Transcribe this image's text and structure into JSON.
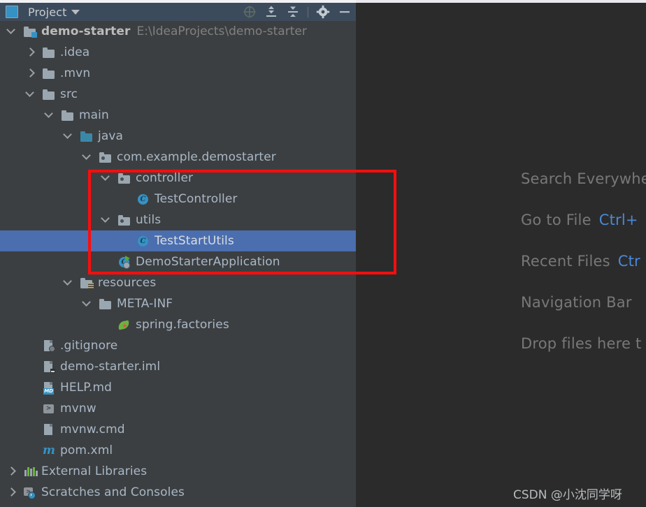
{
  "window": {
    "tool_window": {
      "title": "Project",
      "title_icon": "project-monitor-icon",
      "dropdown_icon": "chevron-down-icon",
      "actions": [
        {
          "name": "select-opened-file-icon",
          "label": "Select Opened File"
        },
        {
          "name": "expand-all-icon",
          "label": "Expand All"
        },
        {
          "name": "collapse-all-icon",
          "label": "Collapse All"
        },
        {
          "name": "settings-gear-icon",
          "label": "Settings"
        },
        {
          "name": "hide-icon",
          "label": "Hide"
        }
      ]
    }
  },
  "tree": {
    "rows": [
      {
        "indent": 0,
        "arrow": "down",
        "icon": "module-folder-icon",
        "label": "demo-starter",
        "bold": true,
        "path": "E:\\IdeaProjects\\demo-starter",
        "selected": false
      },
      {
        "indent": 1,
        "arrow": "right",
        "icon": "folder-icon",
        "label": ".idea",
        "bold": false,
        "path": "",
        "selected": false
      },
      {
        "indent": 1,
        "arrow": "right",
        "icon": "folder-icon",
        "label": ".mvn",
        "bold": false,
        "path": "",
        "selected": false
      },
      {
        "indent": 1,
        "arrow": "down",
        "icon": "folder-icon",
        "label": "src",
        "bold": false,
        "path": "",
        "selected": false
      },
      {
        "indent": 2,
        "arrow": "down",
        "icon": "folder-icon",
        "label": "main",
        "bold": false,
        "path": "",
        "selected": false
      },
      {
        "indent": 3,
        "arrow": "down",
        "icon": "source-root-folder-icon",
        "label": "java",
        "bold": false,
        "path": "",
        "selected": false
      },
      {
        "indent": 4,
        "arrow": "down",
        "icon": "package-icon",
        "label": "com.example.demostarter",
        "bold": false,
        "path": "",
        "selected": false
      },
      {
        "indent": 5,
        "arrow": "down",
        "icon": "package-icon",
        "label": "controller",
        "bold": false,
        "path": "",
        "selected": false
      },
      {
        "indent": 6,
        "arrow": "none",
        "icon": "java-class-icon",
        "label": "TestController",
        "bold": false,
        "path": "",
        "selected": false
      },
      {
        "indent": 5,
        "arrow": "down",
        "icon": "package-icon",
        "label": "utils",
        "bold": false,
        "path": "",
        "selected": false
      },
      {
        "indent": 6,
        "arrow": "none",
        "icon": "java-class-icon",
        "label": "TestStartUtils",
        "bold": false,
        "path": "",
        "selected": true
      },
      {
        "indent": 5,
        "arrow": "none",
        "icon": "spring-boot-app-icon",
        "label": "DemoStarterApplication",
        "bold": false,
        "path": "",
        "selected": false
      },
      {
        "indent": 3,
        "arrow": "down",
        "icon": "resources-folder-icon",
        "label": "resources",
        "bold": false,
        "path": "",
        "selected": false
      },
      {
        "indent": 4,
        "arrow": "down",
        "icon": "folder-icon",
        "label": "META-INF",
        "bold": false,
        "path": "",
        "selected": false
      },
      {
        "indent": 5,
        "arrow": "none",
        "icon": "spring-factories-icon",
        "label": "spring.factories",
        "bold": false,
        "path": "",
        "selected": false
      },
      {
        "indent": 1,
        "arrow": "none",
        "icon": "gitignore-file-icon",
        "label": ".gitignore",
        "bold": false,
        "path": "",
        "selected": false
      },
      {
        "indent": 1,
        "arrow": "none",
        "icon": "iml-file-icon",
        "label": "demo-starter.iml",
        "bold": false,
        "path": "",
        "selected": false
      },
      {
        "indent": 1,
        "arrow": "none",
        "icon": "markdown-file-icon",
        "label": "HELP.md",
        "bold": false,
        "path": "",
        "selected": false
      },
      {
        "indent": 1,
        "arrow": "none",
        "icon": "shell-script-icon",
        "label": "mvnw",
        "bold": false,
        "path": "",
        "selected": false
      },
      {
        "indent": 1,
        "arrow": "none",
        "icon": "cmd-file-icon",
        "label": "mvnw.cmd",
        "bold": false,
        "path": "",
        "selected": false
      },
      {
        "indent": 1,
        "arrow": "none",
        "icon": "maven-pom-icon",
        "label": "pom.xml",
        "bold": false,
        "path": "",
        "selected": false
      },
      {
        "indent": 0,
        "arrow": "right",
        "icon": "external-libraries-icon",
        "label": "External Libraries",
        "bold": false,
        "path": "",
        "selected": false
      },
      {
        "indent": 0,
        "arrow": "right",
        "icon": "scratches-icon",
        "label": "Scratches and Consoles",
        "bold": false,
        "path": "",
        "selected": false
      }
    ]
  },
  "editor": {
    "hints": [
      {
        "action": "Search Everywhere",
        "shortcut": ""
      },
      {
        "action": "Go to File",
        "shortcut": "Ctrl+"
      },
      {
        "action": "Recent Files",
        "shortcut": "Ctr"
      },
      {
        "action": "Navigation Bar",
        "shortcut": ""
      },
      {
        "action": "Drop files here t",
        "shortcut": ""
      }
    ],
    "watermark": "CSDN @小沈同学呀"
  },
  "annotation": {
    "shape": "rectangle",
    "color": "#fb0d0d"
  }
}
